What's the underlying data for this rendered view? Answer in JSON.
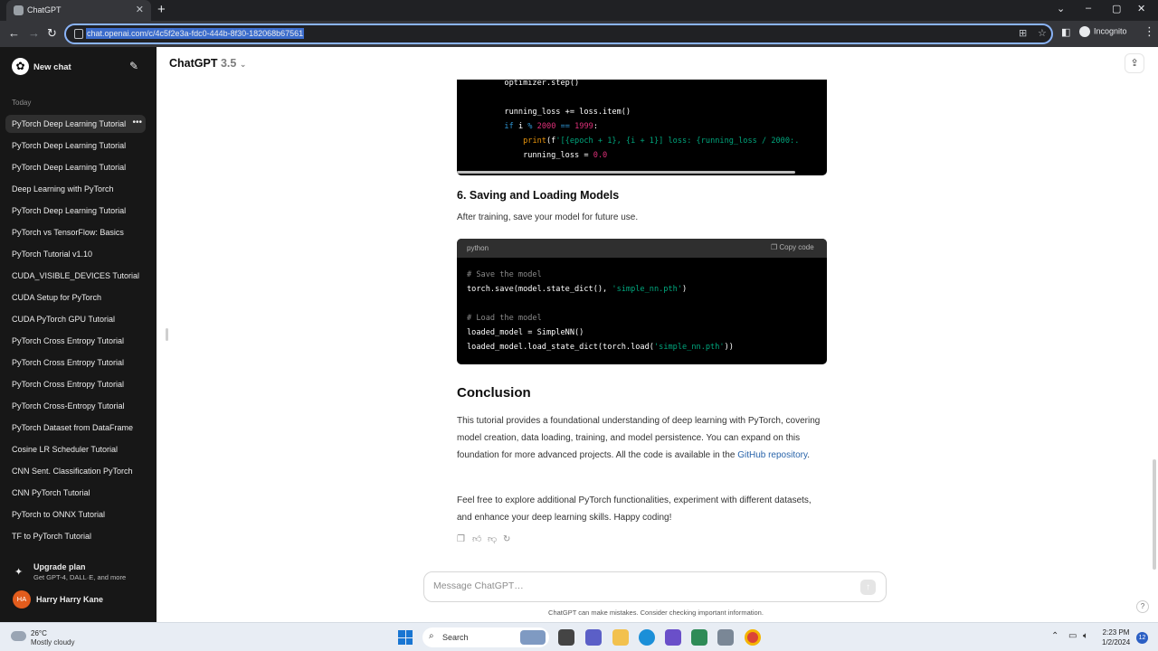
{
  "browser": {
    "tab_title": "ChatGPT",
    "url": "chat.openai.com/c/4c5f2e3a-fdc0-444b-8f30-182068b67561",
    "profile_label": "Incognito"
  },
  "sidebar": {
    "new_chat": "New chat",
    "section": "Today",
    "items": [
      {
        "label": "PyTorch Deep Learning Tutorial"
      },
      {
        "label": "PyTorch Deep Learning Tutorial"
      },
      {
        "label": "PyTorch Deep Learning Tutorial"
      },
      {
        "label": "Deep Learning with PyTorch"
      },
      {
        "label": "PyTorch Deep Learning Tutorial"
      },
      {
        "label": "PyTorch vs TensorFlow: Basics"
      },
      {
        "label": "PyTorch Tutorial v1.10"
      },
      {
        "label": "CUDA_VISIBLE_DEVICES Tutorial"
      },
      {
        "label": "CUDA Setup for PyTorch"
      },
      {
        "label": "CUDA PyTorch GPU Tutorial"
      },
      {
        "label": "PyTorch Cross Entropy Tutorial"
      },
      {
        "label": "PyTorch Cross Entropy Tutorial"
      },
      {
        "label": "PyTorch Cross Entropy Tutorial"
      },
      {
        "label": "PyTorch Cross-Entropy Tutorial"
      },
      {
        "label": "PyTorch Dataset from DataFrame"
      },
      {
        "label": "Cosine LR Scheduler Tutorial"
      },
      {
        "label": "CNN Sent. Classification PyTorch"
      },
      {
        "label": "CNN PyTorch Tutorial"
      },
      {
        "label": "PyTorch to ONNX Tutorial"
      },
      {
        "label": "TF to PyTorch Tutorial"
      }
    ],
    "upgrade_title": "Upgrade plan",
    "upgrade_sub": "Get GPT-4, DALL·E, and more",
    "user_initials": "HA",
    "user_name": "Harry Harry Kane"
  },
  "header": {
    "model_name": "ChatGPT",
    "model_version": "3.5"
  },
  "content": {
    "code1_lines": [
      "        optimizer.step()",
      "",
      "        running_loss += loss.item()",
      "        if i % 2000 == 1999:",
      "            print(f'[{epoch + 1}, {i + 1}] loss: {running_loss / 2000:.",
      "            running_loss = 0.0"
    ],
    "section6_title": "6. Saving and Loading Models",
    "section6_text": "After training, save your model for future use.",
    "code2_lang": "python",
    "code2_copy": "Copy code",
    "conclusion_title": "Conclusion",
    "conclusion_p1": "This tutorial provides a foundational understanding of deep learning with PyTorch, covering model creation, data loading, training, and model persistence. You can expand on this foundation for more advanced projects. All the code is available in the",
    "conclusion_link": "GitHub repository",
    "conclusion_p2": "Feel free to explore additional PyTorch functionalities, experiment with different datasets, and enhance your deep learning skills. Happy coding!"
  },
  "composer": {
    "placeholder": "Message ChatGPT…",
    "disclaimer": "ChatGPT can make mistakes. Consider checking important information."
  },
  "taskbar": {
    "temp": "26°C",
    "condition": "Mostly cloudy",
    "search_label": "Search",
    "time": "2:23 PM",
    "date": "1/2/2024",
    "notifications": "12"
  }
}
